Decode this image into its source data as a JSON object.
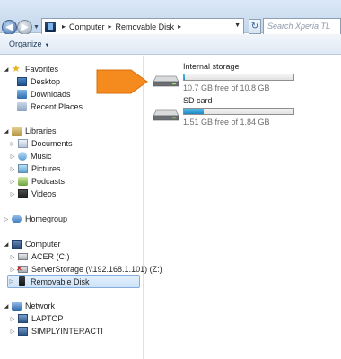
{
  "address": {
    "breadcrumbs": [
      "Computer",
      "Removable Disk"
    ],
    "search_placeholder": "Search Xperia TL"
  },
  "toolbar": {
    "organize_label": "Organize"
  },
  "nav": {
    "favorites": {
      "label": "Favorites",
      "items": [
        "Desktop",
        "Downloads",
        "Recent Places"
      ]
    },
    "libraries": {
      "label": "Libraries",
      "items": [
        "Documents",
        "Music",
        "Pictures",
        "Podcasts",
        "Videos"
      ]
    },
    "homegroup": {
      "label": "Homegroup"
    },
    "computer": {
      "label": "Computer",
      "items": [
        "ACER (C:)",
        "ServerStorage (\\\\192.168.1.101) (Z:)",
        "Removable Disk"
      ]
    },
    "network": {
      "label": "Network",
      "items": [
        "LAPTOP",
        "SIMPLYINTERACTI"
      ]
    }
  },
  "drives": [
    {
      "name": "Internal storage",
      "free_text": "10.7 GB free of 10.8 GB",
      "used_fraction": 0.01
    },
    {
      "name": "SD card",
      "free_text": "1.51 GB free of 1.84 GB",
      "used_fraction": 0.18
    }
  ],
  "colors": {
    "arrow": "#f58a1f",
    "selected": "#cde3f8",
    "bar_fill": "#1b86c2"
  }
}
